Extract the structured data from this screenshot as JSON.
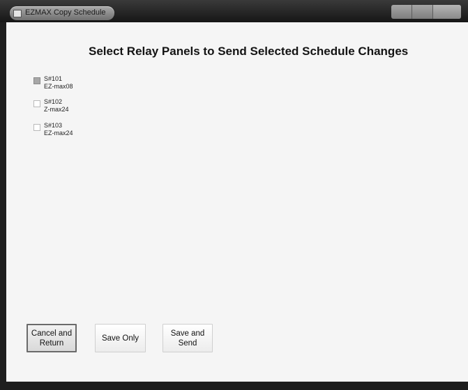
{
  "window": {
    "title": "EZMAX Copy Schedule"
  },
  "heading": "Select Relay Panels to Send Selected Schedule Changes",
  "panels": [
    {
      "id": "S#101",
      "model": "EZ-max08",
      "checked": true
    },
    {
      "id": "S#102",
      "model": "Z-max24",
      "checked": false
    },
    {
      "id": "S#103",
      "model": "EZ-max24",
      "checked": false
    }
  ],
  "buttons": {
    "cancel_line1": "Cancel and",
    "cancel_line2": "Return",
    "save_only": "Save Only",
    "save_send_line1": "Save and",
    "save_send_line2": "Send"
  }
}
